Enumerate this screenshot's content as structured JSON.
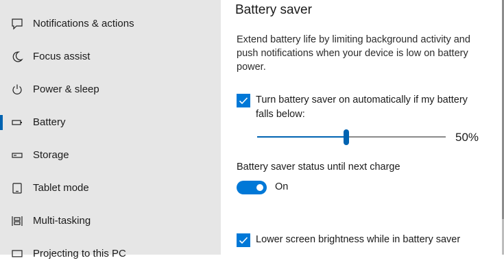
{
  "sidebar": {
    "items": [
      {
        "label": "Notifications & actions",
        "icon": "notifications-icon"
      },
      {
        "label": "Focus assist",
        "icon": "moon-icon"
      },
      {
        "label": "Power & sleep",
        "icon": "power-icon"
      },
      {
        "label": "Battery",
        "icon": "battery-icon",
        "selected": true
      },
      {
        "label": "Storage",
        "icon": "storage-icon"
      },
      {
        "label": "Tablet mode",
        "icon": "tablet-icon"
      },
      {
        "label": "Multi-tasking",
        "icon": "multitasking-icon"
      },
      {
        "label": "Projecting to this PC",
        "icon": "projecting-icon"
      }
    ]
  },
  "main": {
    "title": "Battery saver",
    "description": "Extend battery life by limiting background activity and push notifications when your device is low on battery power.",
    "auto_checkbox": {
      "label_line1": "Turn battery saver on automatically if my battery",
      "label_line2": "falls below:",
      "checked": true
    },
    "slider": {
      "value_text": "50%",
      "value": 50
    },
    "status": {
      "label": "Battery saver status until next charge",
      "toggle_text": "On",
      "on": true
    },
    "brightness_checkbox": {
      "label": "Lower screen brightness while in battery saver",
      "checked": true
    }
  },
  "colors": {
    "accent": "#0078d7",
    "sidebar_bg": "#e6e6e6"
  }
}
